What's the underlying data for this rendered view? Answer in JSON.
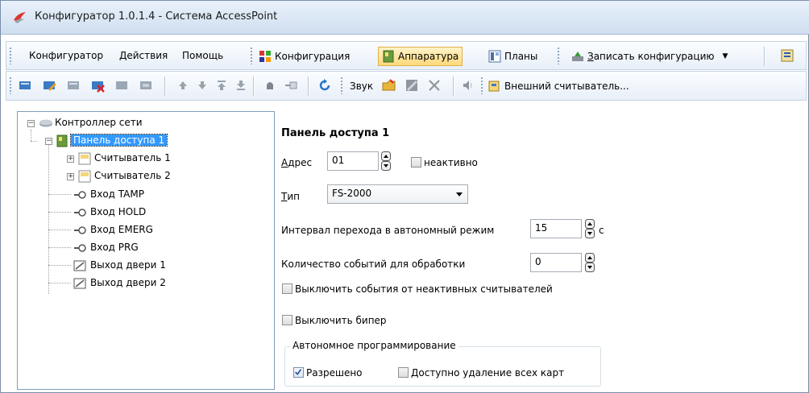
{
  "window": {
    "title": "Конфигуратор 1.0.1.4 - Система AccessPoint"
  },
  "menu": {
    "items": [
      "Конфигуратор",
      "Действия",
      "Помощь"
    ],
    "configuration": "Конфигурация",
    "hardware": "Аппаратура",
    "plans": "Планы",
    "write_prefix": "З",
    "write_rest": "аписать конфигурацию"
  },
  "toolbar": {
    "sound_label": "Звук",
    "ext_reader_label": "Внешний считыватель..."
  },
  "tree": {
    "root": "Контроллер сети",
    "panel": "Панель доступа 1",
    "children": [
      "Считыватель 1",
      "Считыватель 2",
      "Вход TAMP",
      "Вход HOLD",
      "Вход EMERG",
      "Вход PRG",
      "Выход двери 1",
      "Выход двери 2"
    ]
  },
  "form": {
    "heading": "Панель доступа 1",
    "address_label_u": "А",
    "address_label_rest": "дрес",
    "address_value": "01",
    "inactive_label": "неактивно",
    "inactive_checked": false,
    "type_label_u": "Т",
    "type_label_rest": "ип",
    "type_value": "FS-2000",
    "autonomous_label": "Интервал перехода в автономный режим",
    "autonomous_value": "15",
    "autonomous_unit": "с",
    "events_label": "Количество событий для обработки",
    "events_value": "0",
    "disable_events_label": "Выключить события от неактивных считывателей",
    "disable_events_checked": false,
    "disable_beeper_label": "Выключить бипер",
    "disable_beeper_checked": false,
    "group_title": "Автономное программирование",
    "allowed_label": "Разрешено",
    "allowed_checked": true,
    "delete_all_label": "Доступно удаление всех карт",
    "delete_all_checked": false
  }
}
